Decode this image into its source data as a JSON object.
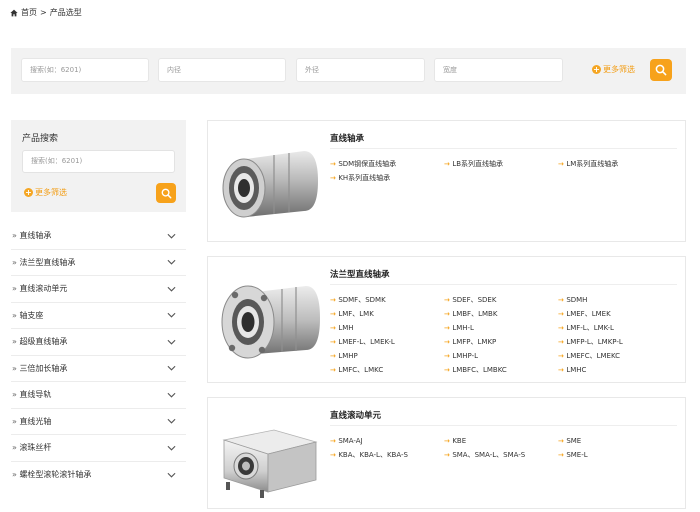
{
  "breadcrumb": {
    "home": "首页",
    "sep": ">",
    "current": "产品选型"
  },
  "search": {
    "keyword_placeholder": "搜索(如：6201)",
    "inner_placeholder": "内径",
    "outer_placeholder": "外径",
    "width_placeholder": "宽度",
    "more_filter": "更多筛选"
  },
  "sidebar": {
    "title": "产品搜索",
    "search_placeholder": "搜索(如：6201)",
    "more_filter": "更多筛选",
    "items": [
      {
        "label": "直线轴承"
      },
      {
        "label": "法兰型直线轴承"
      },
      {
        "label": "直线滚动单元"
      },
      {
        "label": "轴支座"
      },
      {
        "label": "超级直线轴承"
      },
      {
        "label": "三倍加长轴承"
      },
      {
        "label": "直线导轨"
      },
      {
        "label": "直线光轴"
      },
      {
        "label": "滚珠丝杆"
      },
      {
        "label": "螺栓型滚轮滚针轴承"
      }
    ]
  },
  "categories": [
    {
      "title": "直线轴承",
      "links": [
        "SDM钢保直线轴承",
        "LB系列直线轴承",
        "LM系列直线轴承",
        "KH系列直线轴承"
      ]
    },
    {
      "title": "法兰型直线轴承",
      "links": [
        "SDMF、SDMK",
        "SDEF、SDEK",
        "SDMH",
        "LMF、LMK",
        "LMBF、LMBK",
        "LMEF、LMEK",
        "LMH",
        "LMH-L",
        "LMF-L、LMK-L",
        "LMEF-L、LMEK-L",
        "LMFP、LMKP",
        "LMFP-L、LMKP-L",
        "LMHP",
        "LMHP-L",
        "LMEFC、LMEKC",
        "LMFC、LMKC",
        "LMBFC、LMBKC",
        "LMHC"
      ]
    },
    {
      "title": "直线滚动单元",
      "links": [
        "SMA-AJ",
        "KBE",
        "SME",
        "KBA、KBA-L、KBA-S",
        "SMA、SMA-L、SMA-S",
        "SME-L"
      ]
    }
  ],
  "colors": {
    "accent": "#f7a21b",
    "panel": "#f2f2f2"
  }
}
